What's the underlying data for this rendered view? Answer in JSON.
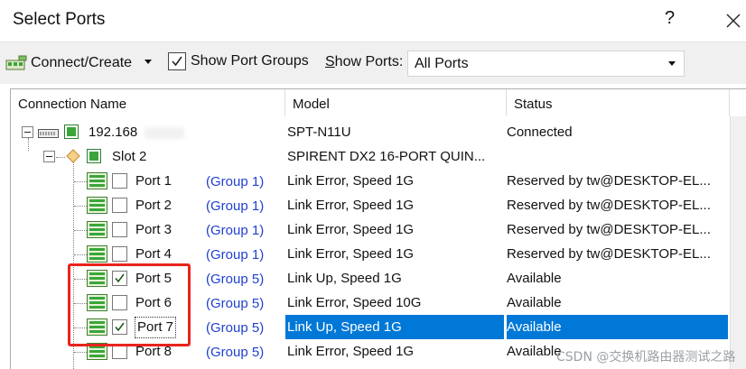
{
  "window": {
    "title": "Select Ports",
    "help_label": "?"
  },
  "toolbar": {
    "connect_label": "Connect/Create",
    "show_port_groups_label": "Show Port Groups",
    "show_port_groups_checked": true,
    "show_ports_prefix": "S",
    "show_ports_rest": "how Ports:",
    "ports_filter_value": "All Ports"
  },
  "columns": {
    "name": "Connection Name",
    "model": "Model",
    "status": "Status"
  },
  "chassis": {
    "ip": "192.168",
    "model": "SPT-N11U",
    "status": "Connected"
  },
  "slot": {
    "name": "Slot 2",
    "model": "SPIRENT DX2 16-PORT QUIN..."
  },
  "ports": [
    {
      "name": "Port 1",
      "group": "(Group 1)",
      "model": "Link Error, Speed 1G",
      "status": "Reserved by tw@DESKTOP-EL...",
      "checked": false,
      "selected": false
    },
    {
      "name": "Port 2",
      "group": "(Group 1)",
      "model": "Link Error, Speed 1G",
      "status": "Reserved by tw@DESKTOP-EL...",
      "checked": false,
      "selected": false
    },
    {
      "name": "Port 3",
      "group": "(Group 1)",
      "model": "Link Error, Speed 1G",
      "status": "Reserved by tw@DESKTOP-EL...",
      "checked": false,
      "selected": false
    },
    {
      "name": "Port 4",
      "group": "(Group 1)",
      "model": "Link Error, Speed 1G",
      "status": "Reserved by tw@DESKTOP-EL...",
      "checked": false,
      "selected": false
    },
    {
      "name": "Port 5",
      "group": "(Group 5)",
      "model": "Link Up, Speed 1G",
      "status": "Available",
      "checked": true,
      "selected": false
    },
    {
      "name": "Port 6",
      "group": "(Group 5)",
      "model": "Link Error, Speed 10G",
      "status": "Available",
      "checked": false,
      "selected": false
    },
    {
      "name": "Port 7",
      "group": "(Group 5)",
      "model": "Link Up, Speed 1G",
      "status": "Available",
      "checked": true,
      "selected": true
    },
    {
      "name": "Port 8",
      "group": "(Group 5)",
      "model": "Link Error, Speed 1G",
      "status": "Available",
      "checked": false,
      "selected": false
    }
  ],
  "watermark": "CSDN @交换机路由器测试之路",
  "colors": {
    "selection": "#0078d7",
    "group_text": "#1f3fd1",
    "highlight_box": "#e8231c",
    "port_icon_green": "#3aa63a"
  }
}
